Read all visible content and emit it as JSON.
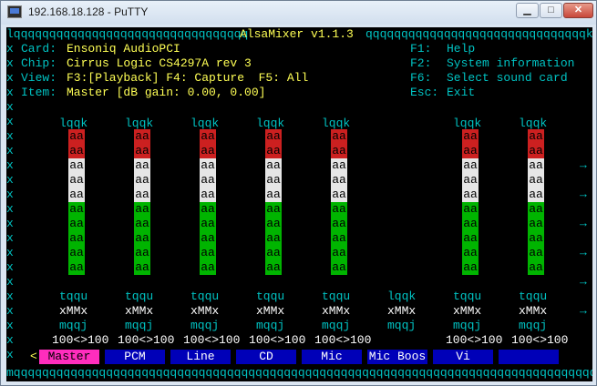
{
  "window": {
    "title": "192.168.18.128 - PuTTY",
    "min_glyph": "▁",
    "max_glyph": "□",
    "close_glyph": "✕"
  },
  "header": {
    "banner": "AlsaMixer v1.1.3"
  },
  "info": {
    "card_label": "Card:",
    "card_value": "Ensoniq AudioPCI",
    "chip_label": "Chip:",
    "chip_value": "Cirrus Logic CS4297A rev 3",
    "view_label": "View:",
    "view_value": "F3:[Playback] F4: Capture  F5: All",
    "item_label": "Item:",
    "item_value": "Master [dB gain: 0.00, 0.00]"
  },
  "keys": [
    {
      "key": "F1:",
      "action": "Help"
    },
    {
      "key": "F2:",
      "action": "System information"
    },
    {
      "key": "F6:",
      "action": "Select sound card"
    },
    {
      "key": "Esc:",
      "action": "Exit"
    }
  ],
  "channels": [
    {
      "name": "Master",
      "top": "lqqk",
      "gauge": "tqqu",
      "mute": "xMMx",
      "bottom": "mqqj",
      "value": "100<>100",
      "selected": true,
      "has_bar": true
    },
    {
      "name": "PCM",
      "top": "lqqk",
      "gauge": "tqqu",
      "mute": "xMMx",
      "bottom": "mqqj",
      "value": "100<>100",
      "selected": false,
      "has_bar": true
    },
    {
      "name": "Line",
      "top": "lqqk",
      "gauge": "tqqu",
      "mute": "xMMx",
      "bottom": "mqqj",
      "value": "100<>100",
      "selected": false,
      "has_bar": true
    },
    {
      "name": "CD",
      "top": "lqqk",
      "gauge": "tqqu",
      "mute": "xMMx",
      "bottom": "mqqj",
      "value": "100<>100",
      "selected": false,
      "has_bar": true
    },
    {
      "name": "Mic",
      "top": "lqqk",
      "gauge": "tqqu",
      "mute": "xMMx",
      "bottom": "mqqj",
      "value": "100<>100",
      "selected": false,
      "has_bar": true
    },
    {
      "name": "Mic Boos",
      "top": "lqqk",
      "gauge": "",
      "mute": "xMMx",
      "bottom": "mqqj",
      "value": "",
      "selected": false,
      "has_bar": false
    },
    {
      "name": "Vi",
      "top": "lqqk",
      "gauge": "tqqu",
      "mute": "xMMx",
      "bottom": "mqqj",
      "value": "100<>100",
      "selected": false,
      "has_bar": true
    },
    {
      "name": "",
      "top": "lqqk",
      "gauge": "tqqu",
      "mute": "xMMx",
      "bottom": "mqqj",
      "value": "100<>100",
      "selected": false,
      "has_bar": true
    }
  ],
  "bar": {
    "red": "aa",
    "white": "aa",
    "green": "aa",
    "left": "x",
    "right": "x"
  },
  "right_arrow": "→",
  "left_arrow": "<",
  "colors": {
    "cyan": "#00c2c2",
    "yellow": "#ffff55",
    "red": "#cc2020",
    "green": "#00b400",
    "white": "#e6e6e6",
    "blue": "#0000b8",
    "magenta": "#ff2dbd"
  }
}
